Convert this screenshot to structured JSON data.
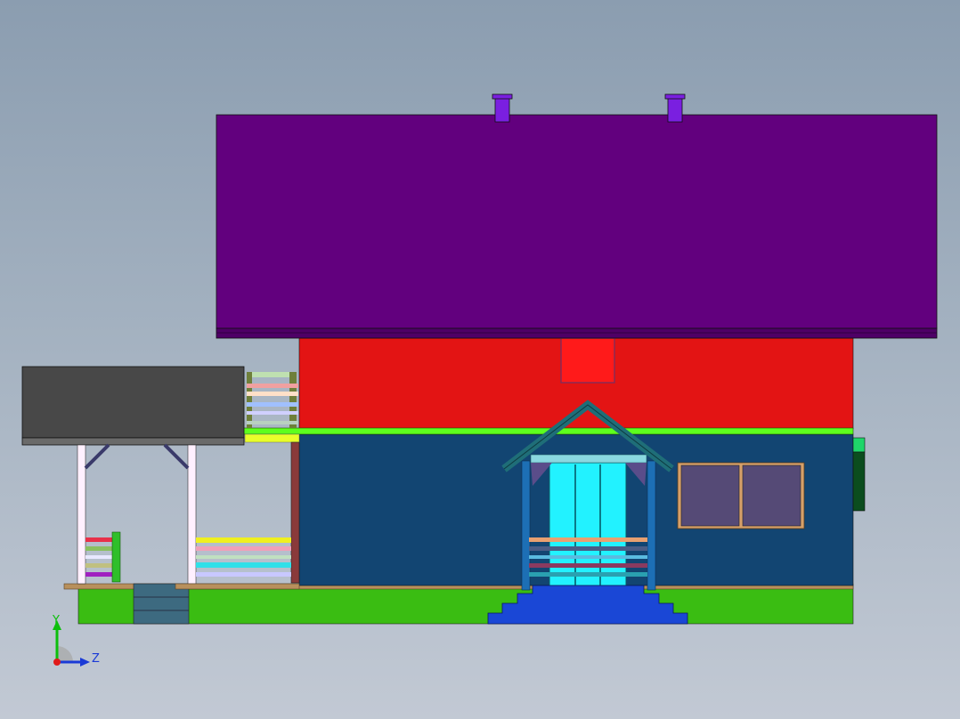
{
  "viewport": {
    "background_top": "#8b9db0",
    "background_bottom": "#c2c9d4"
  },
  "model": {
    "colors": {
      "roof": "#62007e",
      "roof_edge": "#4e0066",
      "chimney": "#7a1fe0",
      "upper_wall": "#e31414",
      "gable_window": "#ff1a1a",
      "trim_band": "#5dff1e",
      "lower_wall": "#124572",
      "ground": "#3abd12",
      "floor_plank": "#b8905c",
      "steps": "#1a47d6",
      "pavilion_roof": "#484848",
      "porch_roof": "#1f6e78",
      "door": "#22f2ff",
      "window": "#554a76",
      "window_frame": "#d6a06a",
      "side_box": "#0b4d1e",
      "side_box_top": "#1fd66a",
      "cellar_stair": "#3d6a80"
    }
  },
  "triad": {
    "y_label": "Y",
    "z_label": "Z"
  }
}
